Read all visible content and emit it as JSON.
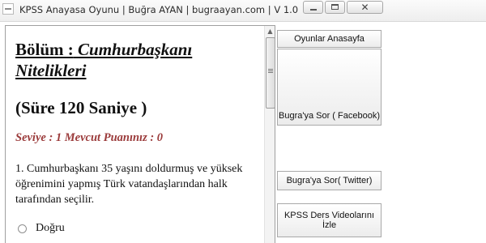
{
  "window": {
    "title": "KPSS Anayasa Oyunu | Buğra AYAN | bugraayan.com | V 1.0",
    "close_glyph": "✕"
  },
  "content": {
    "section_label": "Bölüm :",
    "section_name": "Cumhurbaşkanı Nitelikleri",
    "duration": "(Süre 120 Saniye )",
    "level_score": "Seviye : 1 Mevcut Puanınız : 0",
    "question": "1. Cumhurbaşkanı 35 yaşını doldurmuş ve yüksek öğrenimini yapmış Türk vatandaşlarından halk tarafından seçilir.",
    "option_true": "Doğru"
  },
  "scrollbar": {
    "up_arrow": "▲"
  },
  "sidebar": {
    "btn_home": "Oyunlar Anasayfa",
    "btn_facebook": "Bugra'ya Sor ( Facebook)",
    "btn_twitter": "Bugra'ya Sor( Twitter)",
    "btn_videos": "KPSS Ders Videolarını İzle"
  }
}
